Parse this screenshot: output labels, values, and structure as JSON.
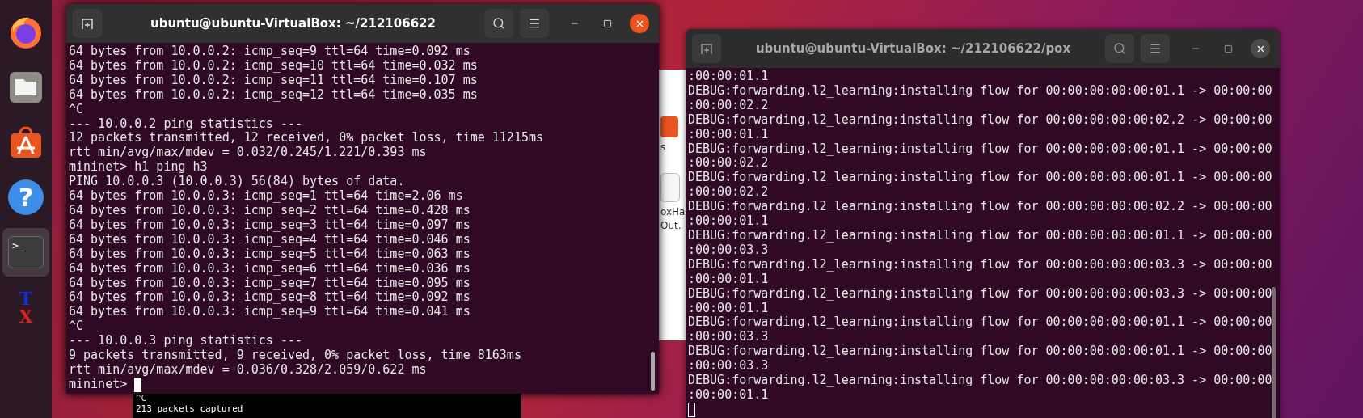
{
  "dock": [
    {
      "kind": "firefox",
      "selected": false
    },
    {
      "kind": "files",
      "selected": false
    },
    {
      "kind": "store",
      "selected": false
    },
    {
      "kind": "help",
      "selected": false,
      "glyph": "?"
    },
    {
      "kind": "terminal",
      "selected": true,
      "glyph": ">_"
    },
    {
      "kind": "tex",
      "selected": false,
      "glyph": "X",
      "glyph_2": "T"
    }
  ],
  "background_window": {
    "labels": [
      "s",
      "oxHa",
      "Out."
    ]
  },
  "capture_window": {
    "lines": [
      "^C",
      "213 packets captured"
    ]
  },
  "terminals": [
    {
      "title": "ubuntu@ubuntu-VirtualBox: ~/212106622",
      "focused": true,
      "prompt": "mininet>",
      "lines": [
        "64 bytes from 10.0.0.2: icmp_seq=9 ttl=64 time=0.092 ms",
        "64 bytes from 10.0.0.2: icmp_seq=10 ttl=64 time=0.032 ms",
        "64 bytes from 10.0.0.2: icmp_seq=11 ttl=64 time=0.107 ms",
        "64 bytes from 10.0.0.2: icmp_seq=12 ttl=64 time=0.035 ms",
        "^C",
        "--- 10.0.0.2 ping statistics ---",
        "12 packets transmitted, 12 received, 0% packet loss, time 11215ms",
        "rtt min/avg/max/mdev = 0.032/0.245/1.221/0.393 ms",
        "mininet> h1 ping h3",
        "PING 10.0.0.3 (10.0.0.3) 56(84) bytes of data.",
        "64 bytes from 10.0.0.3: icmp_seq=1 ttl=64 time=2.06 ms",
        "64 bytes from 10.0.0.3: icmp_seq=2 ttl=64 time=0.428 ms",
        "64 bytes from 10.0.0.3: icmp_seq=3 ttl=64 time=0.097 ms",
        "64 bytes from 10.0.0.3: icmp_seq=4 ttl=64 time=0.046 ms",
        "64 bytes from 10.0.0.3: icmp_seq=5 ttl=64 time=0.063 ms",
        "64 bytes from 10.0.0.3: icmp_seq=6 ttl=64 time=0.036 ms",
        "64 bytes from 10.0.0.3: icmp_seq=7 ttl=64 time=0.095 ms",
        "64 bytes from 10.0.0.3: icmp_seq=8 ttl=64 time=0.092 ms",
        "64 bytes from 10.0.0.3: icmp_seq=9 ttl=64 time=0.041 ms",
        "^C",
        "--- 10.0.0.3 ping statistics ---",
        "9 packets transmitted, 9 received, 0% packet loss, time 8163ms",
        "rtt min/avg/max/mdev = 0.036/0.328/2.059/0.622 ms"
      ]
    },
    {
      "title": "ubuntu@ubuntu-VirtualBox: ~/212106622/pox",
      "focused": false,
      "lines": [
        ":00:00:01.1",
        "DEBUG:forwarding.l2_learning:installing flow for 00:00:00:00:00:01.1 -> 00:00:00",
        ":00:00:02.2",
        "DEBUG:forwarding.l2_learning:installing flow for 00:00:00:00:00:02.2 -> 00:00:00",
        ":00:00:01.1",
        "DEBUG:forwarding.l2_learning:installing flow for 00:00:00:00:00:01.1 -> 00:00:00",
        ":00:00:02.2",
        "DEBUG:forwarding.l2_learning:installing flow for 00:00:00:00:00:01.1 -> 00:00:00",
        ":00:00:02.2",
        "DEBUG:forwarding.l2_learning:installing flow for 00:00:00:00:00:02.2 -> 00:00:00",
        ":00:00:01.1",
        "DEBUG:forwarding.l2_learning:installing flow for 00:00:00:00:00:01.1 -> 00:00:00",
        ":00:00:03.3",
        "DEBUG:forwarding.l2_learning:installing flow for 00:00:00:00:00:03.3 -> 00:00:00",
        ":00:00:01.1",
        "DEBUG:forwarding.l2_learning:installing flow for 00:00:00:00:00:03.3 -> 00:00:00",
        ":00:00:01.1",
        "DEBUG:forwarding.l2_learning:installing flow for 00:00:00:00:00:01.1 -> 00:00:00",
        ":00:00:03.3",
        "DEBUG:forwarding.l2_learning:installing flow for 00:00:00:00:00:01.1 -> 00:00:00",
        ":00:00:03.3",
        "DEBUG:forwarding.l2_learning:installing flow for 00:00:00:00:00:03.3 -> 00:00:00",
        ":00:00:01.1"
      ]
    }
  ]
}
